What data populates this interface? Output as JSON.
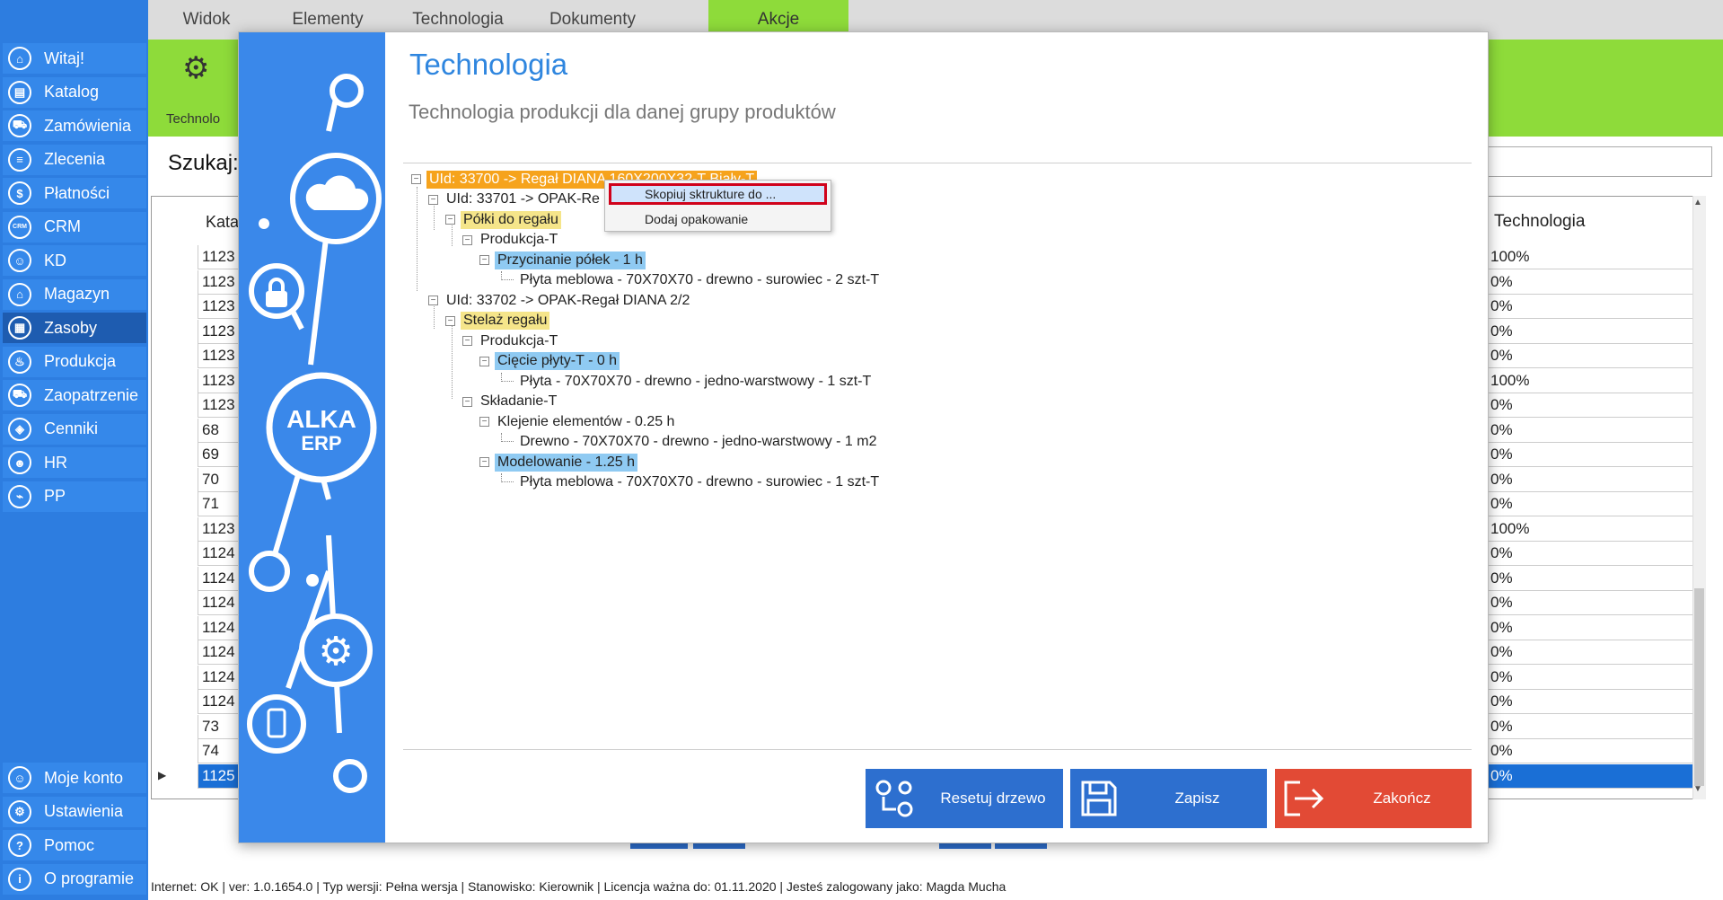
{
  "sidebar": {
    "items": [
      {
        "label": "Witaj!",
        "icon": "home-icon",
        "glyph": "⌂"
      },
      {
        "label": "Katalog",
        "icon": "book-icon",
        "glyph": "▤"
      },
      {
        "label": "Zamówienia",
        "icon": "cart-icon",
        "glyph": "⛟"
      },
      {
        "label": "Zlecenia",
        "icon": "list-icon",
        "glyph": "≡"
      },
      {
        "label": "Płatności",
        "icon": "dollar-icon",
        "glyph": "$"
      },
      {
        "label": "CRM",
        "icon": "crm-icon",
        "glyph": "CRM"
      },
      {
        "label": "KD",
        "icon": "user-icon",
        "glyph": "☺"
      },
      {
        "label": "Magazyn",
        "icon": "warehouse-icon",
        "glyph": "⌂"
      },
      {
        "label": "Zasoby",
        "icon": "resources-icon",
        "glyph": "▦"
      },
      {
        "label": "Produkcja",
        "icon": "production-icon",
        "glyph": "♨"
      },
      {
        "label": "Zaopatrzenie",
        "icon": "supply-icon",
        "glyph": "⛟"
      },
      {
        "label": "Cenniki",
        "icon": "tag-icon",
        "glyph": "◈"
      },
      {
        "label": "HR",
        "icon": "hr-icon",
        "glyph": "☻"
      },
      {
        "label": "PP",
        "icon": "chart-icon",
        "glyph": "⌁"
      }
    ],
    "active_index": 8,
    "bottom_items": [
      {
        "label": "Moje konto",
        "icon": "account-icon",
        "glyph": "☺"
      },
      {
        "label": "Ustawienia",
        "icon": "settings-icon",
        "glyph": "⚙"
      },
      {
        "label": "Pomoc",
        "icon": "help-icon",
        "glyph": "?"
      },
      {
        "label": "O programie",
        "icon": "info-icon",
        "glyph": "i"
      }
    ]
  },
  "menu": {
    "tabs": [
      "Widok",
      "Elementy",
      "Technologia",
      "Dokumenty",
      "Akcje"
    ],
    "active_index": 4
  },
  "ribbon": {
    "tool_label": "Technolo"
  },
  "search": {
    "label": "Szukaj:"
  },
  "grid": {
    "col_left_header": "Kata",
    "col_right_header": "Technologia",
    "rows": [
      {
        "kat": "1123",
        "tech": "100%"
      },
      {
        "kat": "1123",
        "tech": "0%"
      },
      {
        "kat": "1123",
        "tech": "0%"
      },
      {
        "kat": "1123",
        "tech": "0%"
      },
      {
        "kat": "1123",
        "tech": "0%"
      },
      {
        "kat": "1123",
        "tech": "100%"
      },
      {
        "kat": "1123",
        "tech": "0%"
      },
      {
        "kat": "68",
        "tech": "0%"
      },
      {
        "kat": "69",
        "tech": "0%"
      },
      {
        "kat": "70",
        "tech": "0%"
      },
      {
        "kat": "71",
        "tech": "0%"
      },
      {
        "kat": "1123",
        "tech": "100%"
      },
      {
        "kat": "1124",
        "tech": "0%"
      },
      {
        "kat": "1124",
        "tech": "0%"
      },
      {
        "kat": "1124",
        "tech": "0%"
      },
      {
        "kat": "1124",
        "tech": "0%"
      },
      {
        "kat": "1124",
        "tech": "0%"
      },
      {
        "kat": "1124",
        "tech": "0%"
      },
      {
        "kat": "1124",
        "tech": "0%"
      },
      {
        "kat": "73",
        "tech": "0%"
      },
      {
        "kat": "74",
        "tech": "0%"
      },
      {
        "kat": "1125",
        "tech": "0%"
      }
    ],
    "selected_index": 21
  },
  "status": {
    "text": "Internet: OK  |   ver: 1.0.1654.0   |   Typ wersji: Pełna wersja   |   Stanowisko: Kierownik   |   Licencja ważna do: 01.11.2020   |   Jesteś zalogowany jako: Magda Mucha"
  },
  "modal": {
    "title": "Technologia",
    "subtitle": "Technologia produkcji dla danej grupy produktów",
    "logo_line1": "ALKA",
    "logo_line2": "ERP",
    "tree": [
      {
        "text": "UId: 33700 -> Regał DIANA  160X200X32-T Biały-T",
        "level": 0,
        "expander": true,
        "style": "orange"
      },
      {
        "text": "UId: 33701 -> OPAK-Re",
        "level": 1,
        "expander": true,
        "style": "none"
      },
      {
        "text": "Półki do regału",
        "level": 2,
        "expander": true,
        "style": "yellow"
      },
      {
        "text": "Produkcja-T",
        "level": 3,
        "expander": true,
        "style": "none"
      },
      {
        "text": "Przycinanie półek - 1 h",
        "level": 4,
        "expander": true,
        "style": "blue"
      },
      {
        "text": "Płyta meblowa - 70X70X70 -  drewno -  surowiec - 2 szt-T",
        "level": 5,
        "expander": false,
        "style": "none"
      },
      {
        "text": "UId: 33702 -> OPAK-Regał DIANA   2/2",
        "level": 1,
        "expander": true,
        "style": "none"
      },
      {
        "text": "Stelaż regału",
        "level": 2,
        "expander": true,
        "style": "yellow"
      },
      {
        "text": "Produkcja-T",
        "level": 3,
        "expander": true,
        "style": "none"
      },
      {
        "text": "Cięcie płyty-T - 0 h",
        "level": 4,
        "expander": true,
        "style": "blue"
      },
      {
        "text": "Płyta - 70X70X70 -  drewno -  jedno-warstwowy - 1 szt-T",
        "level": 5,
        "expander": false,
        "style": "none"
      },
      {
        "text": "Składanie-T",
        "level": 3,
        "expander": true,
        "style": "none"
      },
      {
        "text": "Klejenie elementów - 0.25 h",
        "level": 4,
        "expander": true,
        "style": "none"
      },
      {
        "text": "Drewno - 70X70X70 -  drewno -  jedno-warstwowy - 1 m2",
        "level": 5,
        "expander": false,
        "style": "none"
      },
      {
        "text": "Modelowanie - 1.25 h",
        "level": 4,
        "expander": true,
        "style": "blue"
      },
      {
        "text": "Płyta meblowa - 70X70X70 -  drewno -  surowiec - 1 szt-T",
        "level": 5,
        "expander": false,
        "style": "none"
      }
    ],
    "context_menu": {
      "copy_label": "Skopiuj sktrukture do ...",
      "pack_label": "Dodaj opakowanie"
    },
    "buttons": {
      "reset": "Resetuj drzewo",
      "save": "Zapisz",
      "close": "Zakończ"
    }
  },
  "colors": {
    "sidebar": "#2d7de0",
    "ribbon": "#8edb3a",
    "accent_blue": "#2f86df",
    "close_red": "#e24a35",
    "highlight_orange": "#f6a31c",
    "highlight_yellow": "#f5e58a",
    "highlight_blue": "#8fcaf2",
    "focus_red": "#d0021b"
  }
}
